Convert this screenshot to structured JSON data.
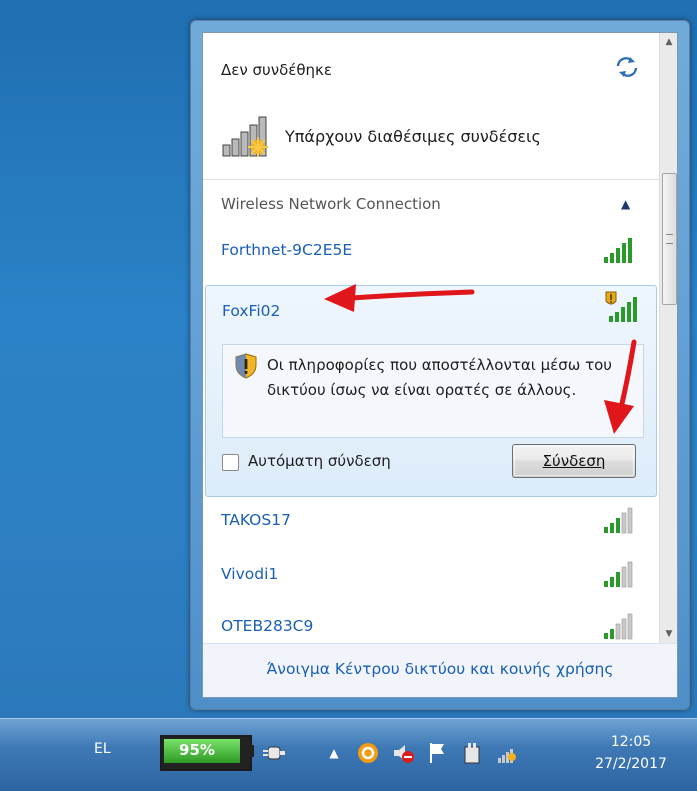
{
  "flyout": {
    "connection_status": "Δεν συνδέθηκε",
    "availability": "Υπάρχουν διαθέσιμες συνδέσεις",
    "section_title": "Wireless Network Connection",
    "networks": [
      {
        "name": "Forthnet-9C2E5E",
        "signal_bars": 5
      },
      {
        "name": "FoxFi02",
        "signal_bars": 5,
        "secured": false,
        "expanded": true
      },
      {
        "name": "TAKOS17",
        "signal_bars": 3
      },
      {
        "name": "Vivodi1",
        "signal_bars": 3
      },
      {
        "name": "OTEB283C9",
        "signal_bars": 2
      }
    ],
    "warning_text": "Οι πληροφορίες που αποστέλλονται μέσω του δικτύου ίσως να είναι ορατές σε άλλους.",
    "auto_connect_label": "Αυτόματη σύνδεση",
    "auto_connect_checked": false,
    "connect_button": "Σύνδεση",
    "footer_link": "Άνοιγμα Κέντρου δικτύου και κοινής χρήσης"
  },
  "taskbar": {
    "language": "EL",
    "battery_percent_label": "95%",
    "battery_level": 0.95,
    "clock_time": "12:05",
    "clock_date": "27/2/2017"
  },
  "colors": {
    "link": "#1a5fb4",
    "arrow": "#e0161b",
    "battery_green": "#2d9b23"
  }
}
